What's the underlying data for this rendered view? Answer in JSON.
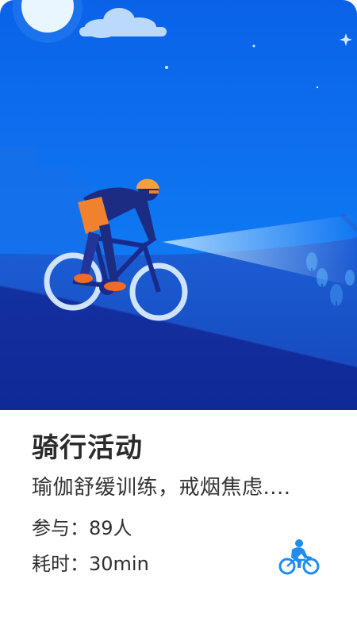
{
  "card": {
    "title": "骑行活动",
    "description": "瑜伽舒缓训练，戒烟焦虑....",
    "participants": "参与：89人",
    "duration": "耗时：30min",
    "activity_icon": "bicycle-rider-icon"
  },
  "colors": {
    "sky": "#0b6cf0",
    "hill_dark": "#1236a8",
    "accent_orange": "#f0812f",
    "icon_blue": "#1e8cf0"
  }
}
